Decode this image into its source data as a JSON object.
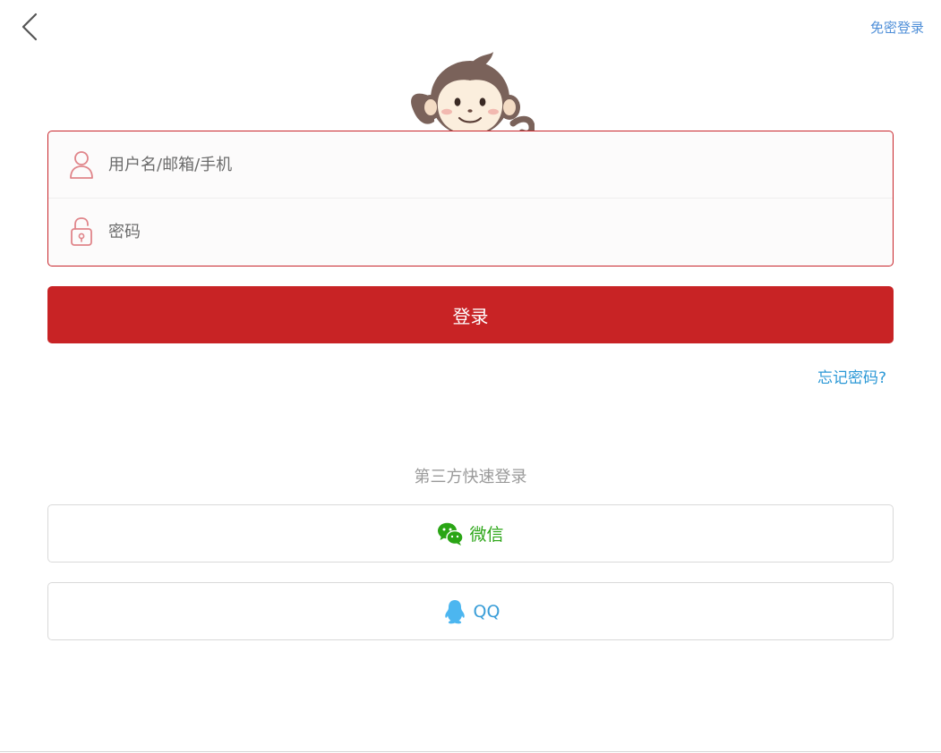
{
  "header": {
    "back_icon": "chevron-left-icon",
    "passwordless_login_label": "免密登录"
  },
  "mascot": {
    "icon": "monkey-mascot-icon"
  },
  "form": {
    "username": {
      "icon": "user-icon",
      "placeholder": "用户名/邮箱/手机",
      "value": ""
    },
    "password": {
      "icon": "unlock-icon",
      "placeholder": "密码",
      "value": ""
    },
    "login_button_label": "登录",
    "forgot_password_label": "忘记密码?"
  },
  "third_party": {
    "title": "第三方快速登录",
    "wechat": {
      "icon": "wechat-icon",
      "label": "微信"
    },
    "qq": {
      "icon": "qq-penguin-icon",
      "label": "QQ"
    }
  },
  "colors": {
    "accent_red": "#c82325",
    "link_blue": "#2b98d6",
    "wechat_green": "#2aa515",
    "qq_blue": "#3a9ed8"
  }
}
